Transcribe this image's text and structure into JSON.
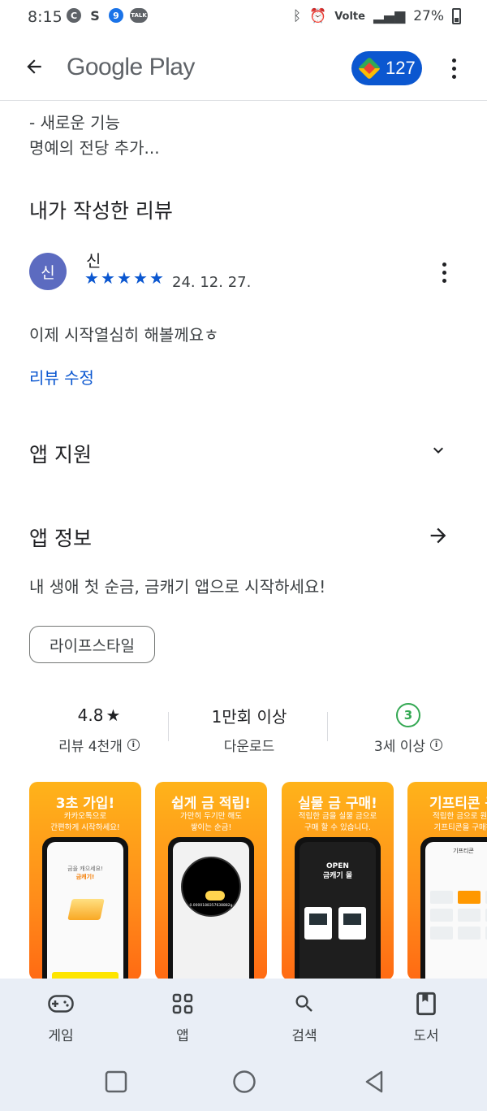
{
  "status_bar": {
    "time": "8:15",
    "left_icons": [
      "c-icon",
      "kakao-s-icon",
      "navigation-9-icon",
      "talk-icon"
    ],
    "signal_label": "Volte",
    "battery": "27%"
  },
  "app_bar": {
    "brand": "Google Play",
    "points": "127"
  },
  "whats_new": {
    "lines": [
      "- 새로운 기능",
      "명예의 전당 추가..."
    ]
  },
  "my_review": {
    "title": "내가 작성한 리뷰",
    "avatar_letter": "신",
    "reviewer": "신",
    "rating": 5,
    "date": "24. 12. 27.",
    "text": "이제 시작열심히 해볼께요ㅎ",
    "edit_label": "리뷰 수정"
  },
  "app_support": {
    "title": "앱 지원"
  },
  "app_info": {
    "title": "앱 정보",
    "description": "내 생애 첫 순금, 금캐기 앱으로 시작하세요!",
    "category": "라이프스타일"
  },
  "stats": {
    "rating_value": "4.8",
    "rating_star": "★",
    "reviews_label": "리뷰 4천개",
    "downloads_value": "1만회 이상",
    "downloads_label": "다운로드",
    "age_badge": "3",
    "age_label": "3세 이상"
  },
  "screenshots": [
    {
      "title": "3초 가입!",
      "sub1": "카카오톡으로",
      "sub2": "간편하게 시작하세요!",
      "screen_line1": "금을 캐으세요!",
      "screen_line2": "금캐기!"
    },
    {
      "title": "쉽게 금 적립!",
      "sub1": "가만히 두기만 해도",
      "sub2": "쌓이는 순금!",
      "screen_value": "0.0000188357638882g"
    },
    {
      "title": "실물 금 구매!",
      "sub1": "적립한 금을 실물 금으로",
      "sub2": "구매 할 수 있습니다.",
      "screen_line1": "OPEN",
      "screen_line2": "금캐기 몰"
    },
    {
      "title": "기프티콘 구",
      "sub1": "적립한 금으로 원하",
      "sub2": "기프티콘을 구매하",
      "screen_header": "기프티콘"
    }
  ],
  "bottom_nav": [
    {
      "label": "게임",
      "icon": "gamepad-icon"
    },
    {
      "label": "앱",
      "icon": "apps-grid-icon"
    },
    {
      "label": "검색",
      "icon": "search-icon"
    },
    {
      "label": "도서",
      "icon": "book-icon"
    }
  ]
}
